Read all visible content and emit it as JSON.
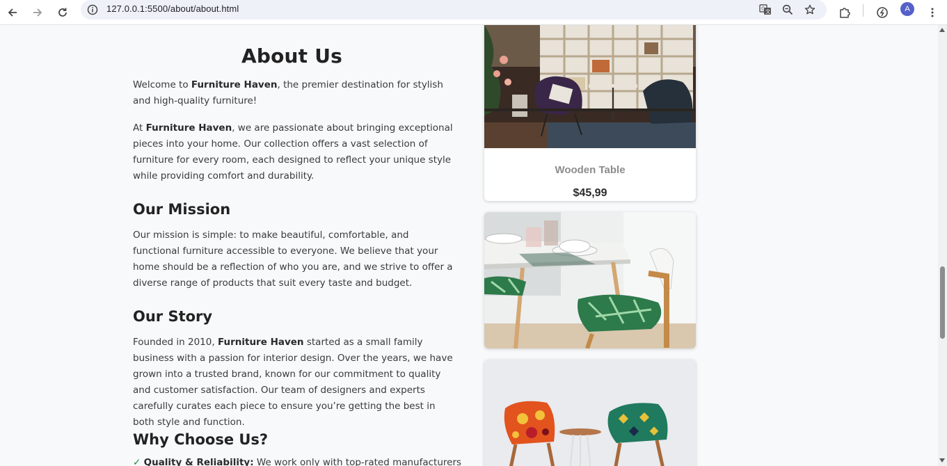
{
  "browser": {
    "url": "127.0.0.1:5500/about/about.html",
    "profile_initial": "A",
    "icons": {
      "back": "arrow-left-icon",
      "forward": "arrow-right-icon",
      "reload": "reload-icon",
      "site_info": "info-icon",
      "translate": "translate-icon",
      "zoom": "zoom-icon",
      "bookmark": "star-icon",
      "extensions": "puzzle-icon",
      "performance": "gauge-icon",
      "menu": "kebab-menu-icon"
    }
  },
  "about": {
    "title": "About Us",
    "intro": {
      "pre": "Welcome to ",
      "brand": "Furniture Haven",
      "post": ", the premier destination for stylish and high-quality furniture!"
    },
    "passion": {
      "pre": "At ",
      "brand": "Furniture Haven",
      "post": ", we are passionate about bringing exceptional pieces into your home. Our collection offers a vast selection of furniture for every room, each designed to reflect your unique style while providing comfort and durability."
    },
    "mission": {
      "heading": "Our Mission",
      "text": "Our mission is simple: to make beautiful, comfortable, and functional furniture accessible to everyone. We believe that your home should be a reflection of who you are, and we strive to offer a diverse range of products that suit every taste and budget."
    },
    "story": {
      "heading": "Our Story",
      "pre": "Founded in 2010, ",
      "brand": "Furniture Haven",
      "post": " started as a small family business with a passion for interior design. Over the years, we have grown into a trusted brand, known for our commitment to quality and customer satisfaction. Our team of designers and experts carefully curates each piece to ensure you’re getting the best in both style and function."
    },
    "why": {
      "heading": "Why Choose Us?",
      "item1_check": "✓",
      "item1_label": "Quality & Reliability:",
      "item1_text": " We work only with top-rated manufacturers"
    }
  },
  "products": [
    {
      "name": "Wooden Table",
      "price": "$45,99"
    }
  ],
  "colors": {
    "page_bg": "#f8f9fb",
    "check": "#1e8a3a",
    "avatar": "#5560c8"
  }
}
